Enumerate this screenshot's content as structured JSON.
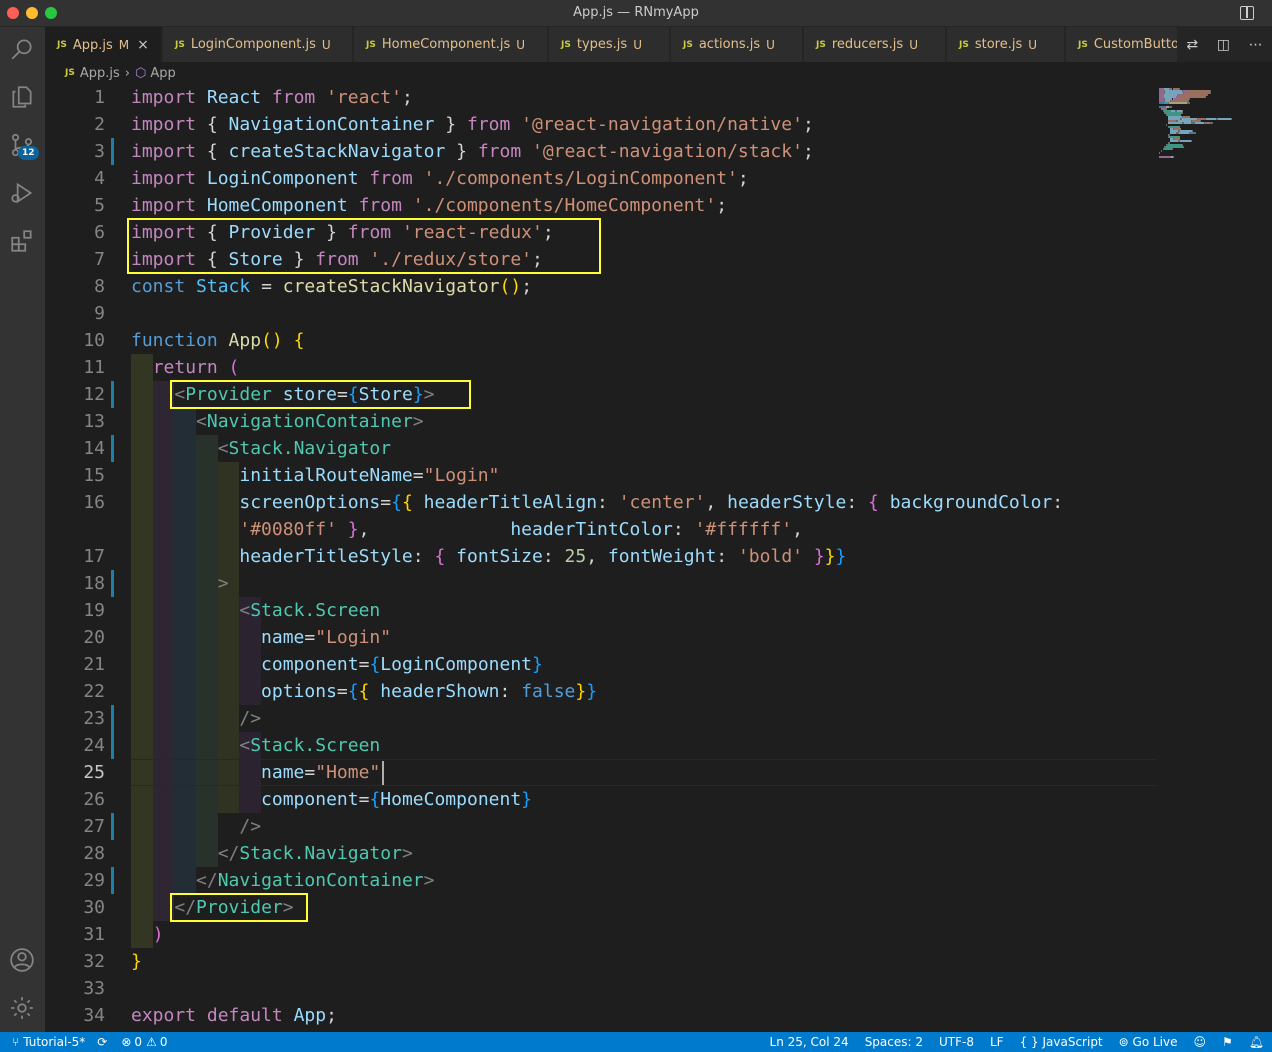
{
  "window": {
    "title": "App.js — RNmyApp"
  },
  "activity_bar": {
    "scm_badge": "12"
  },
  "tabs": [
    {
      "name": "App.js",
      "status": "M",
      "active": true
    },
    {
      "name": "LoginComponent.js",
      "status": "U"
    },
    {
      "name": "HomeComponent.js",
      "status": "U"
    },
    {
      "name": "types.js",
      "status": "U"
    },
    {
      "name": "actions.js",
      "status": "U"
    },
    {
      "name": "reducers.js",
      "status": "U"
    },
    {
      "name": "store.js",
      "status": "U"
    },
    {
      "name": "CustomButton"
    }
  ],
  "tab_prefix": "JS",
  "breadcrumb": {
    "file": "App.js",
    "symbol": "App"
  },
  "line_numbers": [
    "1",
    "2",
    "3",
    "4",
    "5",
    "6",
    "7",
    "8",
    "9",
    "10",
    "11",
    "12",
    "13",
    "14",
    "15",
    "16",
    "",
    "17",
    "18",
    "19",
    "20",
    "21",
    "22",
    "23",
    "24",
    "25",
    "26",
    "27",
    "28",
    "29",
    "30",
    "31",
    "32",
    "33",
    "34"
  ],
  "code_lines": [
    [
      [
        "kw",
        "import "
      ],
      [
        "id",
        "React "
      ],
      [
        "kw",
        "from "
      ],
      [
        "str",
        "'react'"
      ],
      [
        "",
        "; "
      ]
    ],
    [
      [
        "kw",
        "import "
      ],
      [
        "",
        "{ "
      ],
      [
        "id",
        "NavigationContainer "
      ],
      [
        "",
        "} "
      ],
      [
        "kw",
        "from "
      ],
      [
        "str",
        "'@react-navigation/native'"
      ],
      [
        "",
        ";"
      ]
    ],
    [
      [
        "kw",
        "import "
      ],
      [
        "",
        "{ "
      ],
      [
        "id",
        "createStackNavigator "
      ],
      [
        "",
        "} "
      ],
      [
        "kw",
        "from "
      ],
      [
        "str",
        "'@react-navigation/stack'"
      ],
      [
        "",
        ";"
      ]
    ],
    [
      [
        "kw",
        "import "
      ],
      [
        "id",
        "LoginComponent "
      ],
      [
        "kw",
        "from "
      ],
      [
        "str",
        "'./components/LoginComponent'"
      ],
      [
        "",
        ";"
      ]
    ],
    [
      [
        "kw",
        "import "
      ],
      [
        "id",
        "HomeComponent "
      ],
      [
        "kw",
        "from "
      ],
      [
        "str",
        "'./components/HomeComponent'"
      ],
      [
        "",
        ";"
      ]
    ],
    [
      [
        "kw",
        "import "
      ],
      [
        "",
        "{ "
      ],
      [
        "id",
        "Provider "
      ],
      [
        "",
        "} "
      ],
      [
        "kw",
        "from "
      ],
      [
        "str",
        "'react-redux'"
      ],
      [
        "",
        ";"
      ]
    ],
    [
      [
        "kw",
        "import "
      ],
      [
        "",
        "{ "
      ],
      [
        "id",
        "Store "
      ],
      [
        "",
        "} "
      ],
      [
        "kw",
        "from "
      ],
      [
        "str",
        "'./redux/store'"
      ],
      [
        "",
        ";"
      ]
    ],
    [
      [
        "kb",
        "const "
      ],
      [
        "cn",
        "Stack "
      ],
      [
        "",
        "= "
      ],
      [
        "fn",
        "createStackNavigator"
      ],
      [
        "p1",
        "()"
      ],
      [
        "",
        ";"
      ]
    ],
    [],
    [
      [
        "kb",
        "function "
      ],
      [
        "fn",
        "App"
      ],
      [
        "p1",
        "() {"
      ]
    ],
    [
      [
        "",
        "  "
      ],
      [
        "kw",
        "return "
      ],
      [
        "p2",
        "("
      ]
    ],
    [
      [
        "",
        "    "
      ],
      [
        "br",
        "<"
      ],
      [
        "tg",
        "Provider "
      ],
      [
        "id",
        "store"
      ],
      [
        "",
        "="
      ],
      [
        "p3",
        "{"
      ],
      [
        "id",
        "Store"
      ],
      [
        "p3",
        "}"
      ],
      [
        "br",
        ">"
      ]
    ],
    [
      [
        "",
        "      "
      ],
      [
        "br",
        "<"
      ],
      [
        "tg",
        "NavigationContainer"
      ],
      [
        "br",
        ">"
      ]
    ],
    [
      [
        "",
        "        "
      ],
      [
        "br",
        "<"
      ],
      [
        "tg",
        "Stack.Navigator"
      ]
    ],
    [
      [
        "",
        "          "
      ],
      [
        "id",
        "initialRouteName"
      ],
      [
        "",
        "="
      ],
      [
        "str",
        "\"Login\""
      ]
    ],
    [
      [
        "",
        "          "
      ],
      [
        "id",
        "screenOptions"
      ],
      [
        "",
        "="
      ],
      [
        "p3",
        "{"
      ],
      [
        "p1",
        "{ "
      ],
      [
        "id",
        "headerTitleAlign"
      ],
      [
        "",
        ": "
      ],
      [
        "str",
        "'center'"
      ],
      [
        "",
        ", "
      ],
      [
        "id",
        "headerStyle"
      ],
      [
        "",
        ": "
      ],
      [
        "p2",
        "{ "
      ],
      [
        "id",
        "backgroundColor"
      ],
      [
        "",
        ":"
      ]
    ],
    [
      [
        "",
        "          "
      ],
      [
        "str",
        "'#0080ff' "
      ],
      [
        "p2",
        "}"
      ],
      [
        "",
        ",             "
      ],
      [
        "id",
        "headerTintColor"
      ],
      [
        "",
        ": "
      ],
      [
        "str",
        "'#ffffff'"
      ],
      [
        "",
        ","
      ]
    ],
    [
      [
        "",
        "          "
      ],
      [
        "id",
        "headerTitleStyle"
      ],
      [
        "",
        ": "
      ],
      [
        "p2",
        "{ "
      ],
      [
        "id",
        "fontSize"
      ],
      [
        "",
        ": "
      ],
      [
        "num",
        "25"
      ],
      [
        "",
        ", "
      ],
      [
        "id",
        "fontWeight"
      ],
      [
        "",
        ": "
      ],
      [
        "str",
        "'bold' "
      ],
      [
        "p2",
        "}"
      ],
      [
        "p1",
        "}"
      ],
      [
        "p3",
        "}"
      ]
    ],
    [
      [
        "",
        "        "
      ],
      [
        "br",
        ">"
      ]
    ],
    [
      [
        "",
        "          "
      ],
      [
        "br",
        "<"
      ],
      [
        "tg",
        "Stack.Screen"
      ]
    ],
    [
      [
        "",
        "            "
      ],
      [
        "id",
        "name"
      ],
      [
        "",
        "="
      ],
      [
        "str",
        "\"Login\""
      ]
    ],
    [
      [
        "",
        "            "
      ],
      [
        "id",
        "component"
      ],
      [
        "",
        "="
      ],
      [
        "p3",
        "{"
      ],
      [
        "id",
        "LoginComponent"
      ],
      [
        "p3",
        "}"
      ]
    ],
    [
      [
        "",
        "            "
      ],
      [
        "id",
        "options"
      ],
      [
        "",
        "="
      ],
      [
        "p3",
        "{"
      ],
      [
        "p1",
        "{ "
      ],
      [
        "id",
        "headerShown"
      ],
      [
        "",
        ": "
      ],
      [
        "kb",
        "false"
      ],
      [
        "p1",
        "}"
      ],
      [
        "p3",
        "}"
      ]
    ],
    [
      [
        "",
        "          "
      ],
      [
        "br",
        "/>"
      ]
    ],
    [
      [
        "",
        "          "
      ],
      [
        "br",
        "<"
      ],
      [
        "tg",
        "Stack.Screen"
      ]
    ],
    [
      [
        "",
        "            "
      ],
      [
        "id",
        "name"
      ],
      [
        "",
        "="
      ],
      [
        "str",
        "\"Home\""
      ]
    ],
    [
      [
        "",
        "            "
      ],
      [
        "id",
        "component"
      ],
      [
        "",
        "="
      ],
      [
        "p3",
        "{"
      ],
      [
        "id",
        "HomeComponent"
      ],
      [
        "p3",
        "}"
      ]
    ],
    [
      [
        "",
        "          "
      ],
      [
        "br",
        "/>"
      ]
    ],
    [
      [
        "",
        "        "
      ],
      [
        "br",
        "</"
      ],
      [
        "tg",
        "Stack.Navigator"
      ],
      [
        "br",
        ">"
      ]
    ],
    [
      [
        "",
        "      "
      ],
      [
        "br",
        "</"
      ],
      [
        "tg",
        "NavigationContainer"
      ],
      [
        "br",
        ">"
      ]
    ],
    [
      [
        "",
        "    "
      ],
      [
        "br",
        "</"
      ],
      [
        "tg",
        "Provider"
      ],
      [
        "br",
        ">"
      ]
    ],
    [
      [
        "",
        "  "
      ],
      [
        "p2",
        ")"
      ]
    ],
    [
      [
        "p1",
        "}"
      ]
    ],
    [],
    [
      [
        "kw",
        "export "
      ],
      [
        "kw",
        "default "
      ],
      [
        "id",
        "App"
      ],
      [
        "",
        ";"
      ]
    ]
  ],
  "status_bar": {
    "branch": "Tutorial-5*",
    "errors": "0",
    "warnings": "0",
    "position": "Ln 25, Col 24",
    "spaces": "Spaces: 2",
    "encoding": "UTF-8",
    "eol": "LF",
    "language": "JavaScript",
    "go_live": "Go Live"
  }
}
